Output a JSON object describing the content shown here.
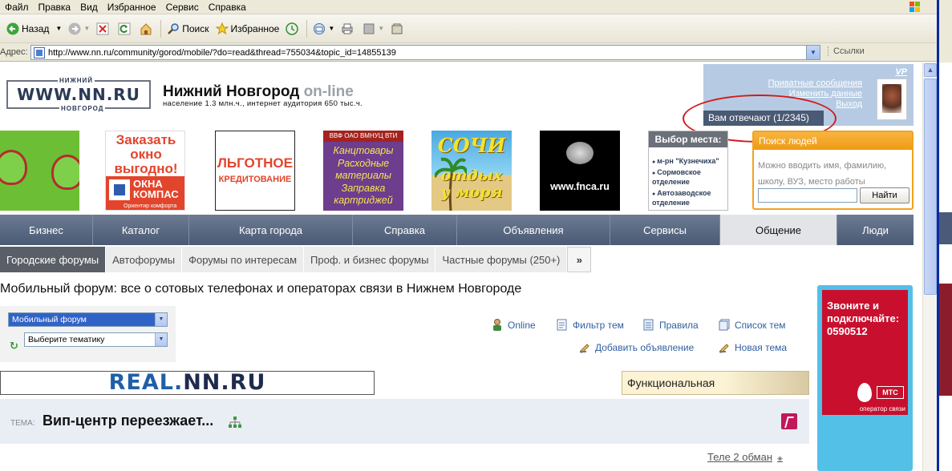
{
  "menu": [
    "Файл",
    "Правка",
    "Вид",
    "Избранное",
    "Сервис",
    "Справка"
  ],
  "toolbar": {
    "back": "Назад",
    "search": "Поиск",
    "favorites": "Избранное"
  },
  "address": {
    "label": "Адрес:",
    "url": "http://www.nn.ru/community/gorod/mobile/?do=read&thread=755034&topic_id=14855139",
    "links": "Ссылки"
  },
  "site": {
    "logo_main": "WWW.NN.RU",
    "logo_top": "НИЖНИЙ",
    "logo_bottom": "НОВГОРОД",
    "city": "Нижний Новгород",
    "online": "on-line",
    "subtitle": "население 1.3 млн.ч., интернет аудитория 650 тыс.ч."
  },
  "userbox": {
    "vp": "VP",
    "links": [
      "Приватные сообщения",
      "Изменить данные",
      "Выход"
    ],
    "answering": "Вам отвечают (1/2345)"
  },
  "banners": {
    "okna_title": "Заказать окно выгодно!",
    "okna_brand_1": "ОКНА",
    "okna_brand_2": "КОМПАС",
    "okna_slogan": "Ориентир комфорта",
    "credit_1": "ЛЬГОТНОЕ",
    "credit_2": "КРЕДИТОВАНИЕ",
    "vbf_header": "ВВФ ОАО ВМНУЦ ВТИ",
    "vbf_text": [
      "Канцтовары",
      "Расходные",
      "материалы",
      "Заправка",
      "картриджей"
    ],
    "sochi_1": "СОЧИ",
    "sochi_2": "отдых",
    "sochi_3": "у моря",
    "fnca": "www.fnca.ru",
    "place_header": "Выбор места:",
    "place_items": [
      "м-рн \"Кузнечиха\"",
      "Сормовское отделение",
      "Автозаводское отделение"
    ]
  },
  "people_search": {
    "header": "Поиск людей",
    "desc_1": "Можно вводить имя, фамилию,",
    "desc_2": "школу, ВУЗ, место работы",
    "button": "Найти"
  },
  "nav": [
    "Бизнес",
    "Каталог",
    "Карта города",
    "Справка",
    "Объявления",
    "Сервисы",
    "Общение",
    "Люди"
  ],
  "nav_active": "Общение",
  "subnav": [
    "Городские форумы",
    "Автофорумы",
    "Форумы по интересам",
    "Проф. и бизнес форумы",
    "Частные форумы (250+)"
  ],
  "subnav_more": "»",
  "forum_title": "Мобильный форум: все о сотовых телефонах и операторах связи в Нижнем Новгороде",
  "selects": {
    "forum": "Мобильный форум",
    "theme": "Выберите тематику"
  },
  "actions": {
    "online": "Online",
    "filter": "Фильтр тем",
    "rules": "Правила",
    "list": "Список тем",
    "add_ad": "Добавить объявление",
    "new_topic": "Новая тема"
  },
  "real_banner": {
    "part1": "REAL.",
    "part2": "NN.RU"
  },
  "func_banner": "Функциональная",
  "topic": {
    "label": "ТЕМА:",
    "title": "Вип-центр переезжает..."
  },
  "next_link": "Теле 2 обман",
  "mts": {
    "text_1": "Звоните и",
    "text_2": "подключайте:",
    "text_3": "0590512",
    "logo": "МТС",
    "operator": "оператор связи"
  },
  "colors": {
    "nav_bg": "#4a5a74",
    "userbox_bg": "#b6cbe3",
    "people_border": "#f3a21f",
    "link": "#2f5fa0",
    "mts_red": "#c8102e"
  }
}
